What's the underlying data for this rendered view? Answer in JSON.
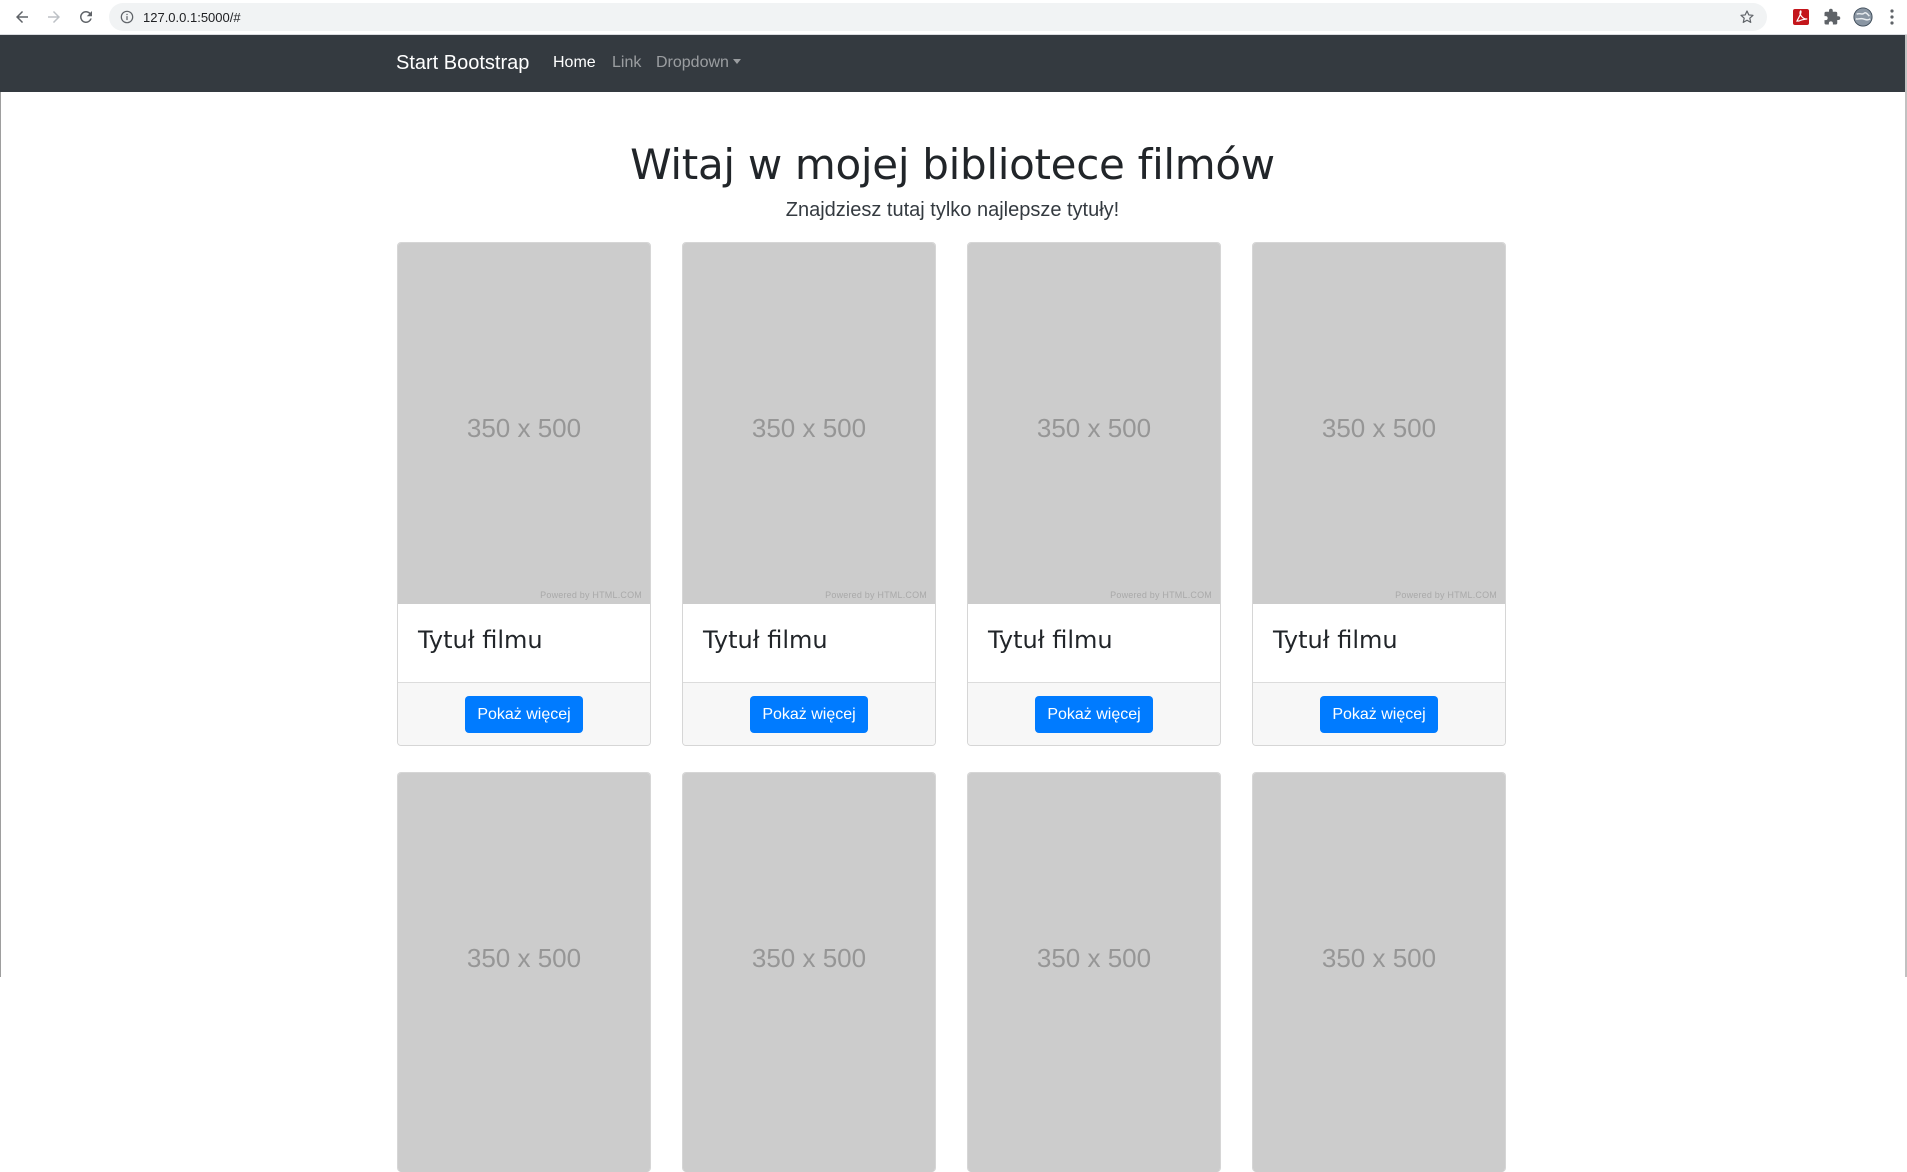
{
  "browser": {
    "url": "127.0.0.1:5000/#"
  },
  "navbar": {
    "brand": "Start Bootstrap",
    "links": [
      "Home",
      "Link",
      "Dropdown"
    ]
  },
  "hero": {
    "heading": "Witaj w mojej bibliotece filmów",
    "lead": "Znajdziesz tutaj tylko najlepsze tytuły!"
  },
  "cards": [
    {
      "placeholder": "350 x 500",
      "powered": "Powered by HTML.COM",
      "title": "Tytuł filmu",
      "button": "Pokaż więcej"
    },
    {
      "placeholder": "350 x 500",
      "powered": "Powered by HTML.COM",
      "title": "Tytuł filmu",
      "button": "Pokaż więcej"
    },
    {
      "placeholder": "350 x 500",
      "powered": "Powered by HTML.COM",
      "title": "Tytuł filmu",
      "button": "Pokaż więcej"
    },
    {
      "placeholder": "350 x 500",
      "powered": "Powered by HTML.COM",
      "title": "Tytuł filmu",
      "button": "Pokaż więcej"
    },
    {
      "placeholder": "350 x 500"
    },
    {
      "placeholder": "350 x 500"
    },
    {
      "placeholder": "350 x 500"
    },
    {
      "placeholder": "350 x 500"
    }
  ],
  "colors": {
    "navbar_bg": "#343a40",
    "primary": "#007bff",
    "placeholder_bg": "#cccccc"
  }
}
